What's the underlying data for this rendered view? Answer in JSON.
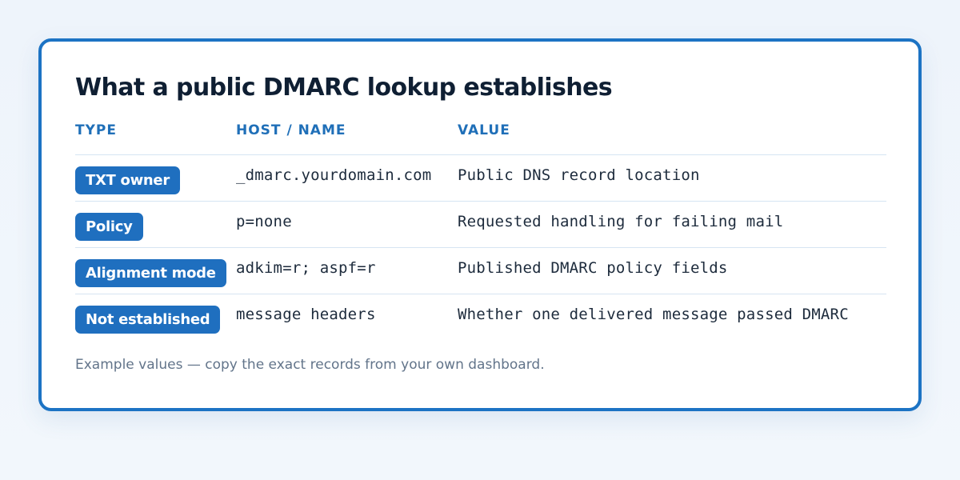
{
  "card": {
    "title": "What a public DMARC lookup establishes",
    "footnote": "Example values — copy the exact records from your own dashboard."
  },
  "table": {
    "headers": {
      "type": "TYPE",
      "host": "HOST / NAME",
      "value": "VALUE"
    },
    "rows": [
      {
        "type": "TXT owner",
        "host": "_dmarc.yourdomain.com",
        "value": "Public DNS record location"
      },
      {
        "type": "Policy",
        "host": "p=none",
        "value": "Requested handling for failing mail"
      },
      {
        "type": "Alignment mode",
        "host": "adkim=r; aspf=r",
        "value": "Published DMARC policy fields"
      },
      {
        "type": "Not established",
        "host": "message headers",
        "value": "Whether one delivered message passed DMARC"
      }
    ]
  },
  "colors": {
    "accent": "#1f6fbf",
    "border": "#1c73c4",
    "header_text": "#1f6fb8",
    "body_text": "#1d2b3c",
    "muted_text": "#62748a"
  }
}
